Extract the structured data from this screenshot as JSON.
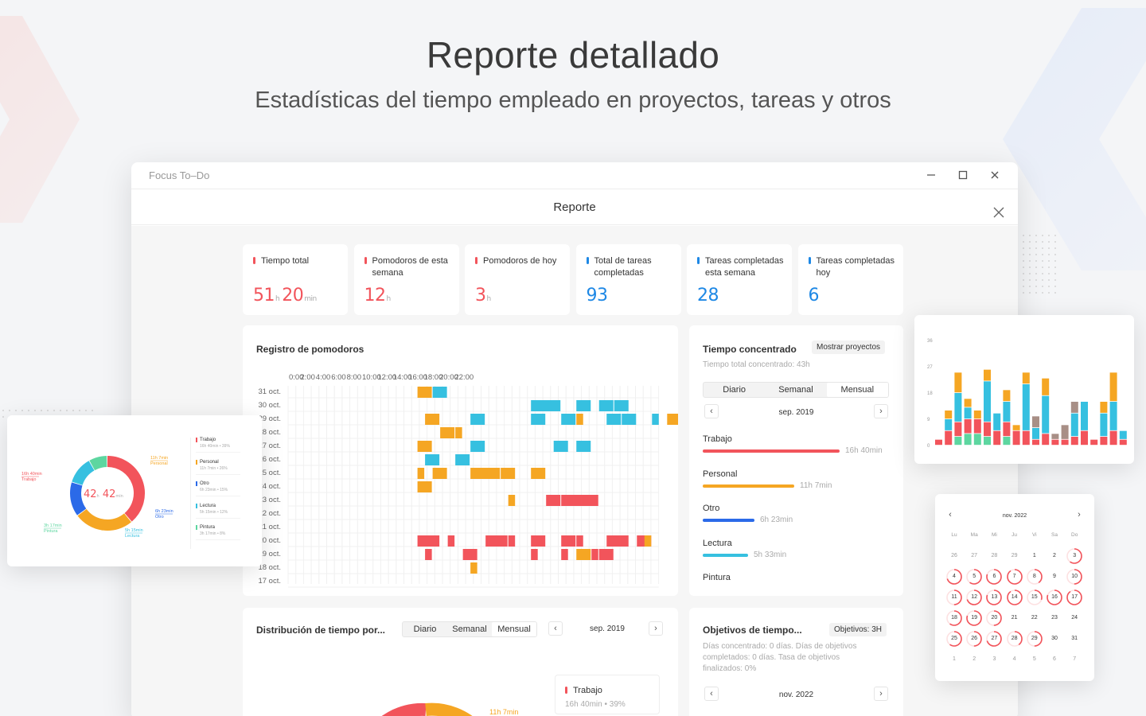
{
  "hero": {
    "title": "Reporte detallado",
    "subtitle": "Estadísticas del tiempo empleado en proyectos, tareas y otros"
  },
  "window": {
    "app_title": "Focus To–Do",
    "report_title": "Reporte"
  },
  "stats": [
    {
      "label": "Tiempo total",
      "value": "51",
      "unit": "h",
      "value2": "20",
      "unit2": "min",
      "color": "#f2545b"
    },
    {
      "label": "Pomodoros de esta semana",
      "value": "12",
      "unit": "h",
      "color": "#f2545b"
    },
    {
      "label": "Pomodoros de hoy",
      "value": "3",
      "unit": "h",
      "color": "#f2545b"
    },
    {
      "label": "Total de tareas completadas",
      "value": "93",
      "color": "#1e88e5"
    },
    {
      "label": "Tareas completadas esta semana",
      "value": "28",
      "color": "#1e88e5"
    },
    {
      "label": "Tareas completadas hoy",
      "value": "6",
      "color": "#1e88e5"
    }
  ],
  "pomodoro_log": {
    "title": "Registro de pomodoros",
    "hours": [
      "0:00",
      "2:00",
      "4:00",
      "6:00",
      "8:00",
      "10:00",
      "12:00",
      "14:00",
      "16:00",
      "18:00",
      "20:00",
      "22:00"
    ],
    "days": [
      "31 oct.",
      "30 oct.",
      "29 oct.",
      "28 oct.",
      "27 oct.",
      "26 oct.",
      "25 oct.",
      "24 oct.",
      "23 oct.",
      "22 oct.",
      "21 oct.",
      "20 oct.",
      "19 oct.",
      "18 oct.",
      "17 oct."
    ]
  },
  "focus_time": {
    "title": "Tiempo concentrado",
    "button": "Mostrar proyectos",
    "subtitle": "Tiempo total concentrado: 43h",
    "tabs": [
      "Diario",
      "Semanal",
      "Mensual"
    ],
    "active_tab": "Mensual",
    "period": "sep. 2019",
    "items": [
      {
        "label": "Trabajo",
        "value": "16h 40min",
        "fraction": 1.0,
        "color": "#f2545b"
      },
      {
        "label": "Personal",
        "value": "11h 7min",
        "fraction": 0.67,
        "color": "#f5a623"
      },
      {
        "label": "Otro",
        "value": "6h 23min",
        "fraction": 0.38,
        "color": "#2b6ae8"
      },
      {
        "label": "Lectura",
        "value": "5h 33min",
        "fraction": 0.33,
        "color": "#36c0e0"
      },
      {
        "label": "Pintura",
        "value": "",
        "fraction": 0.0,
        "color": "#5dd6a0"
      }
    ]
  },
  "distribution": {
    "title": "Distribución de tiempo por...",
    "tabs": [
      "Diario",
      "Semanal",
      "Mensual"
    ],
    "active_tab": "Mensual",
    "period": "sep. 2019",
    "legend_label": "Trabajo",
    "legend_sub": "16h 40min • 39%",
    "slice_label": "11h 7min"
  },
  "goals": {
    "title": "Objetivos de tiempo...",
    "button": "Objetivos: 3H",
    "text": "Días concentrado: 0 días. Días de objetivos completados: 0 días. Tasa de objetivos finalizados: 0%",
    "period": "nov. 2022"
  },
  "donut_popup": {
    "center_value": "42",
    "center_unit": "h",
    "center_value2": "42",
    "center_unit2": "min",
    "labels": [
      {
        "time": "11h 7min",
        "name": "Personal",
        "color": "#f5a623"
      },
      {
        "time": "16h 40min",
        "name": "Trabajo",
        "color": "#f2545b"
      },
      {
        "time": "6h 23min",
        "name": "Otro",
        "color": "#2b6ae8"
      },
      {
        "time": "5h 15min",
        "name": "Lectura",
        "color": "#36c0e0"
      },
      {
        "time": "3h 17min",
        "name": "Pintura",
        "color": "#5dd6a0"
      }
    ],
    "legend": [
      {
        "name": "Trabajo",
        "sub": "16h 40min • 39%",
        "color": "#f2545b"
      },
      {
        "name": "Personal",
        "sub": "11h 7min • 26%",
        "color": "#f5a623"
      },
      {
        "name": "Otro",
        "sub": "6h 23min • 15%",
        "color": "#2b6ae8"
      },
      {
        "name": "Lectura",
        "sub": "5h 15min • 12%",
        "color": "#36c0e0"
      },
      {
        "name": "Pintura",
        "sub": "3h 17min • 8%",
        "color": "#5dd6a0"
      }
    ],
    "chart_data": {
      "type": "pie",
      "categories": [
        "Trabajo",
        "Personal",
        "Otro",
        "Lectura",
        "Pintura"
      ],
      "values": [
        39,
        26,
        15,
        12,
        8
      ]
    }
  },
  "bar_popup": {
    "chart_data": {
      "type": "bar",
      "stacked": true,
      "yticks": [
        "36",
        "27",
        "18",
        "9",
        "0"
      ],
      "ylim": [
        0,
        36
      ],
      "series": [
        {
          "color": "#5dd6a0",
          "values": [
            0,
            0,
            3,
            4,
            4,
            3,
            0,
            3,
            0,
            0,
            0,
            0,
            0,
            0,
            0,
            0,
            0,
            0,
            0,
            0
          ]
        },
        {
          "color": "#f2545b",
          "values": [
            2,
            5,
            5,
            5,
            5,
            5,
            5,
            5,
            5,
            5,
            2,
            4,
            2,
            2,
            3,
            5,
            2,
            3,
            5,
            2
          ]
        },
        {
          "color": "#36c0e0",
          "values": [
            0,
            4,
            10,
            4,
            0,
            14,
            6,
            7,
            0,
            16,
            4,
            13,
            0,
            0,
            8,
            10,
            0,
            8,
            10,
            3
          ]
        },
        {
          "color": "#f5a623",
          "values": [
            0,
            3,
            7,
            3,
            3,
            4,
            0,
            4,
            2,
            4,
            0,
            6,
            0,
            0,
            0,
            0,
            0,
            4,
            10,
            0
          ]
        },
        {
          "color": "#a88f86",
          "values": [
            0,
            0,
            0,
            0,
            0,
            0,
            0,
            0,
            0,
            0,
            4,
            0,
            2,
            5,
            4,
            0,
            0,
            0,
            0,
            0
          ]
        }
      ]
    }
  },
  "calendar_popup": {
    "month": "nov. 2022",
    "weekdays": [
      "Lu",
      "Ma",
      "Mi",
      "Ju",
      "Vi",
      "Sa",
      "Do"
    ],
    "weeks": [
      [
        "26",
        "27",
        "28",
        "29",
        "1",
        "2",
        "3"
      ],
      [
        "4",
        "5",
        "6",
        "7",
        "8",
        "9",
        "10"
      ],
      [
        "11",
        "12",
        "13",
        "14",
        "15",
        "16",
        "17"
      ],
      [
        "18",
        "19",
        "20",
        "21",
        "22",
        "23",
        "24"
      ],
      [
        "25",
        "26",
        "27",
        "28",
        "29",
        "30",
        "31"
      ],
      [
        "1",
        "2",
        "3",
        "4",
        "5",
        "6",
        "7"
      ]
    ],
    "ringed": [
      [
        0,
        0,
        0,
        0,
        0,
        0,
        0.6
      ],
      [
        0.7,
        0.6,
        0.8,
        0.9,
        0.4,
        0,
        0.5
      ],
      [
        0.5,
        0.7,
        0.8,
        0.9,
        0.3,
        0.8,
        0.9
      ],
      [
        0.6,
        0.8,
        0.5,
        0,
        0,
        0,
        0
      ],
      [
        0.6,
        0.5,
        0.7,
        0.4,
        0.5,
        0,
        0
      ],
      [
        0,
        0,
        0,
        0,
        0,
        0,
        0
      ]
    ]
  }
}
